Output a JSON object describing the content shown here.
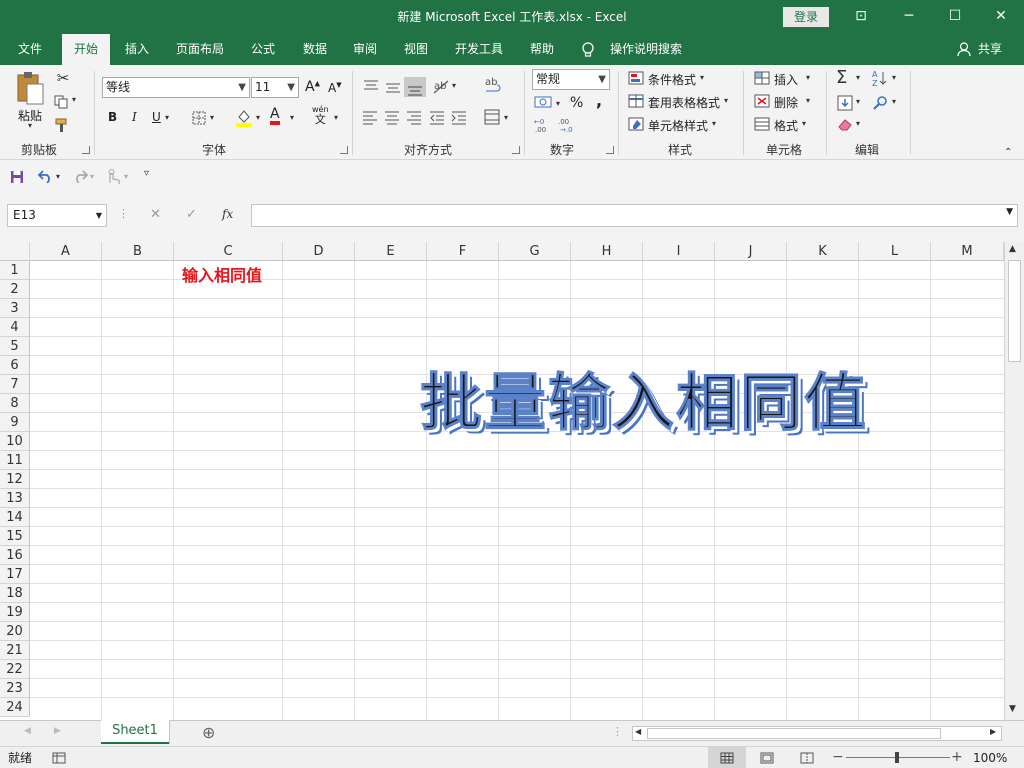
{
  "window": {
    "title": "新建 Microsoft Excel 工作表.xlsx  -  Excel",
    "login": "登录",
    "ribbon_opts": "⊡",
    "minimize": "─",
    "maximize": "☐",
    "close": "✕"
  },
  "tabs": [
    "文件",
    "开始",
    "插入",
    "页面布局",
    "公式",
    "数据",
    "审阅",
    "视图",
    "开发工具",
    "帮助",
    "操作说明搜索"
  ],
  "share": "共享",
  "ribbon": {
    "clipboard": {
      "label": "剪贴板",
      "paste": "粘贴"
    },
    "font": {
      "label": "字体",
      "name": "等线",
      "size": "11",
      "bold": "B",
      "italic": "I",
      "underline": "U",
      "grow": "A",
      "shrink": "A",
      "color_glyph": "A",
      "phonetic_top": "wén",
      "phonetic_bottom": "文"
    },
    "align": {
      "label": "对齐方式"
    },
    "number": {
      "label": "数字",
      "format": "常规",
      "percent": "%",
      "comma": ","
    },
    "styles": {
      "label": "样式",
      "cond": "条件格式",
      "table": "套用表格格式",
      "cell": "单元格样式"
    },
    "cells": {
      "label": "单元格",
      "insert": "插入",
      "delete": "删除",
      "format": "格式"
    },
    "editing": {
      "label": "编辑"
    }
  },
  "formula_bar": {
    "name_box": "E13",
    "fx": "fx",
    "formula": ""
  },
  "columns": [
    "A",
    "B",
    "C",
    "D",
    "E",
    "F",
    "G",
    "H",
    "I",
    "J",
    "K",
    "L",
    "M"
  ],
  "rows": [
    "1",
    "2",
    "3",
    "4",
    "5",
    "6",
    "7",
    "8",
    "9",
    "10",
    "11",
    "12",
    "13",
    "14",
    "15",
    "16",
    "17",
    "18",
    "19",
    "20",
    "21",
    "22",
    "23",
    "24"
  ],
  "cells": {
    "C1": "输入相同值"
  },
  "wordart": "批量输入相同值",
  "sheets": [
    "Sheet1"
  ],
  "status": {
    "ready": "就绪",
    "zoom": "100%"
  },
  "colors": {
    "brand": "#217346",
    "cell_text": "#e8141c"
  }
}
